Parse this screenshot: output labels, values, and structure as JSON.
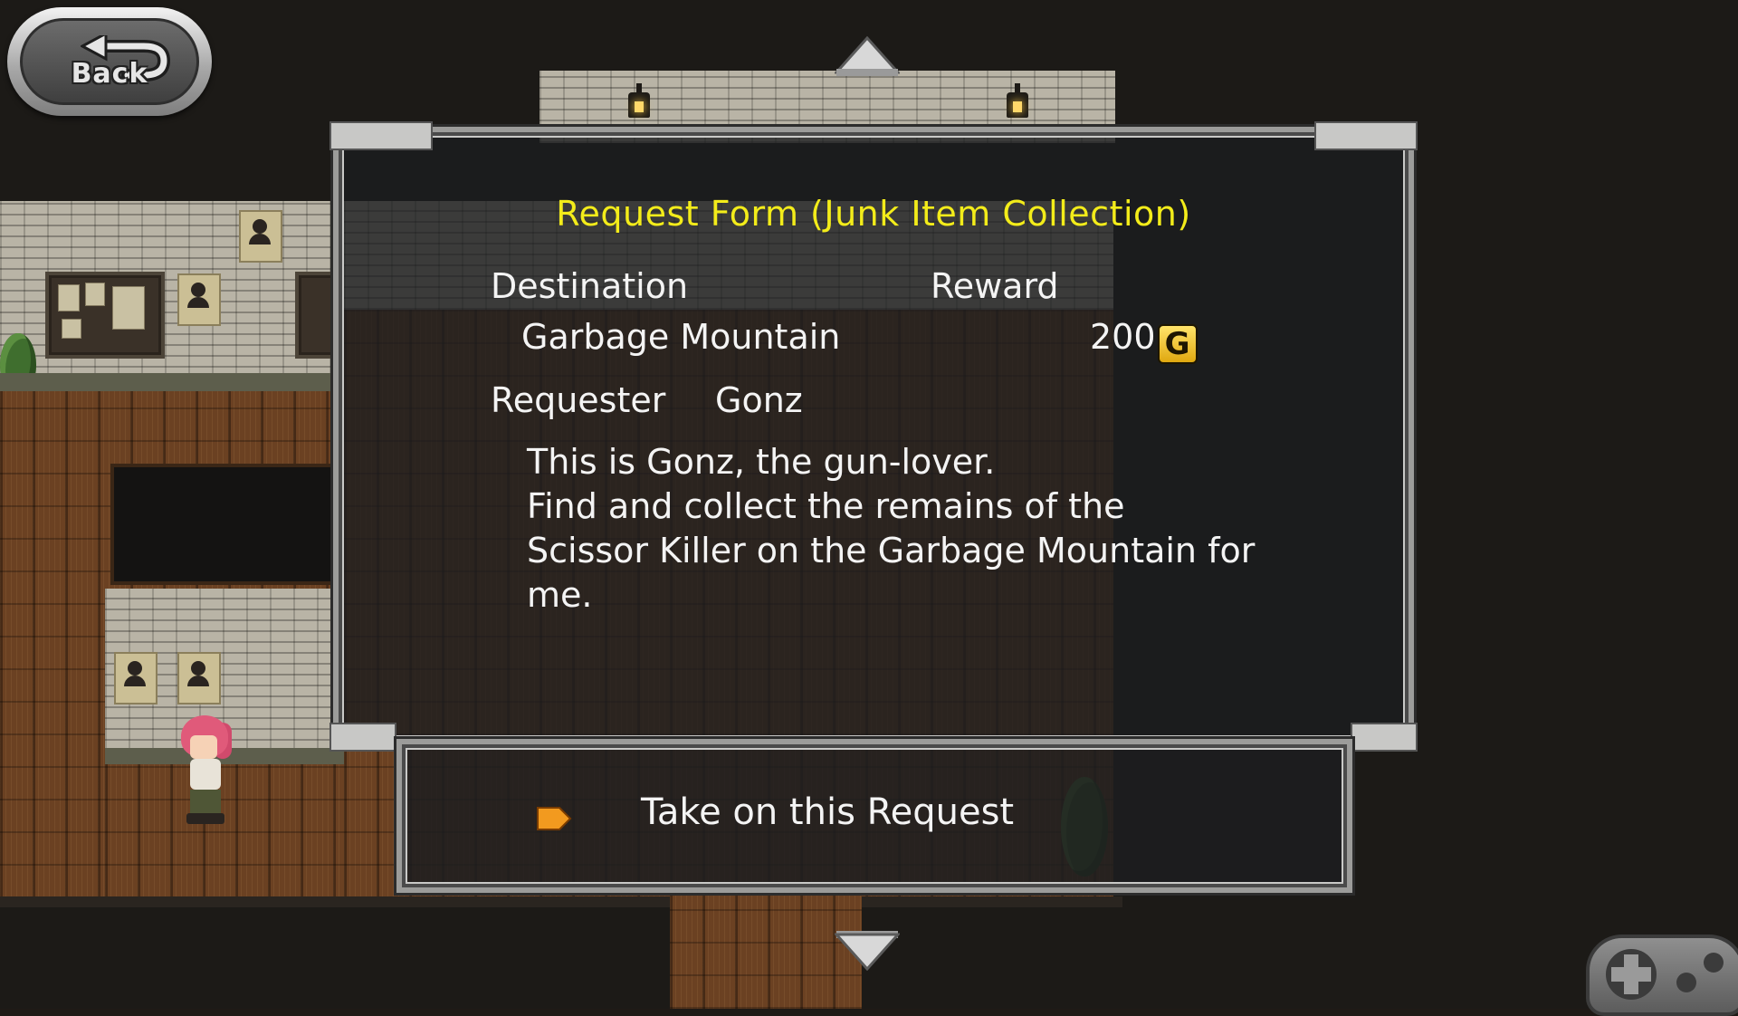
{
  "navigation": {
    "back_label": "Back"
  },
  "request": {
    "title": "Request Form (Junk Item Collection)",
    "destination_label": "Destination",
    "destination_value": "Garbage Mountain",
    "reward_label": "Reward",
    "reward_amount": "200",
    "reward_currency": "G",
    "requester_label": "Requester",
    "requester_name": "Gonz",
    "description_lines": [
      "This is Gonz, the gun-lover.",
      "Find and collect the remains of the",
      "Scissor Killer on the Garbage Mountain for",
      "me."
    ]
  },
  "actions": {
    "accept_label": "Take on this Request"
  },
  "colors": {
    "title": "#f3ec1a",
    "text": "#f4f4f4",
    "panel_border": "#9c9c9a",
    "accent_arrow": "#f29a1f"
  },
  "icons": {
    "back": "back-arrow-icon",
    "scroll_up": "triangle-up-icon",
    "scroll_down": "triangle-down-icon",
    "cursor": "orange-arrow-cursor-icon",
    "gold": "gold-coin-icon",
    "gamepad": "gamepad-icon"
  }
}
